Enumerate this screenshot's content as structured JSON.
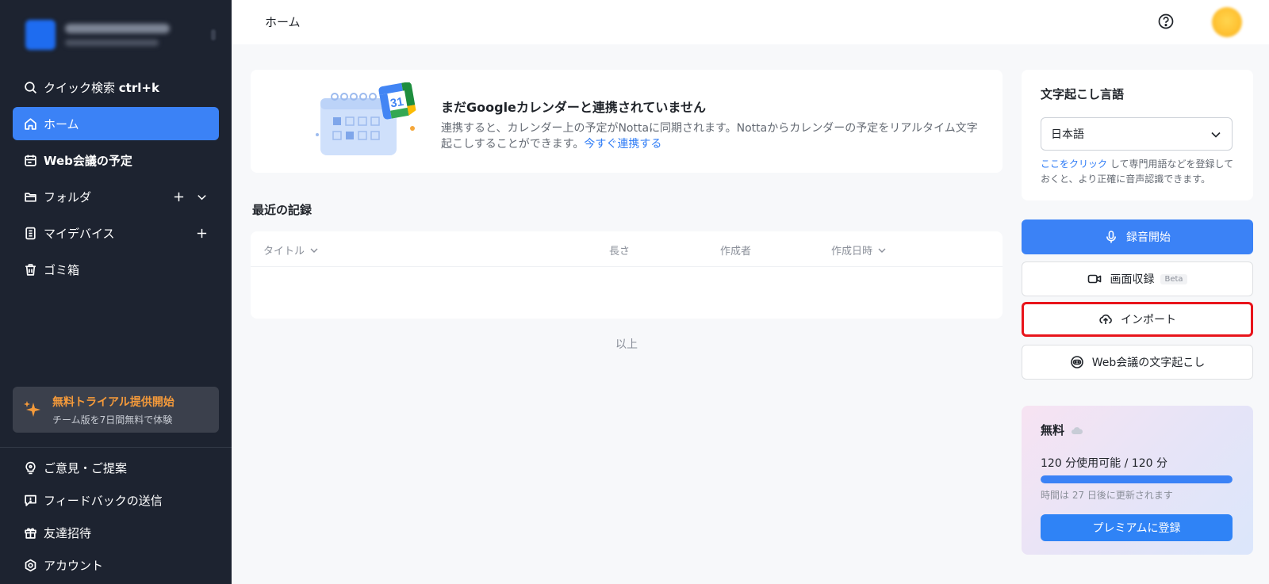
{
  "header": {
    "title": "ホーム",
    "help_icon": "question-circle-icon"
  },
  "sidebar": {
    "items": [
      {
        "label": "クイック検索 ",
        "shortcut": "ctrl+k",
        "icon": "search-icon"
      },
      {
        "label": "ホーム",
        "icon": "home-icon",
        "active": true
      },
      {
        "label": "Web会議の予定",
        "icon": "calendar-icon"
      },
      {
        "label": "フォルダ",
        "icon": "folder-icon"
      },
      {
        "label": "マイデバイス",
        "icon": "device-icon"
      },
      {
        "label": "ゴミ箱",
        "icon": "trash-icon"
      }
    ],
    "trial": {
      "title": "無料トライアル提供開始",
      "subtitle": "チーム版を7日間無料で体験"
    },
    "bottom": [
      {
        "label": "ご意見・ご提案",
        "icon": "lightbulb-icon"
      },
      {
        "label": "フィードバックの送信",
        "icon": "feedback-icon"
      },
      {
        "label": "友達招待",
        "icon": "gift-icon"
      },
      {
        "label": "アカウント",
        "icon": "gear-icon"
      }
    ]
  },
  "banner": {
    "title": "まだGoogleカレンダーと連携されていません",
    "text": "連携すると、カレンダー上の予定がNottaに同期されます。Nottaからカレンダーの予定をリアルタイム文字起こしすることができます。",
    "link": "今すぐ連携する",
    "calendar_number": "31"
  },
  "records": {
    "title": "最近の記録",
    "columns": [
      "タイトル",
      "長さ",
      "作成者",
      "作成日時"
    ],
    "end_label": "以上"
  },
  "language": {
    "title": "文字起こし言語",
    "selected": "日本語",
    "hint_link": "ここをクリック",
    "hint_text": " して専門用語などを登録しておくと、より正確に音声認識できます。"
  },
  "actions": {
    "record": "録音開始",
    "screen_record": "画面収録",
    "beta": "Beta",
    "import": "インポート",
    "web_meeting": "Web会議の文字起こし"
  },
  "plan": {
    "title": "無料",
    "usage": "120 分使用可能 / 120 分",
    "progress": 1.0,
    "renew": "時間は 27 日後に更新されます",
    "upgrade": "プレミアムに登録"
  },
  "colors": {
    "accent": "#3b82f6",
    "sidebar_bg": "#1d2330",
    "trial_text": "#f59a3a",
    "highlight_border": "#e8141b"
  }
}
